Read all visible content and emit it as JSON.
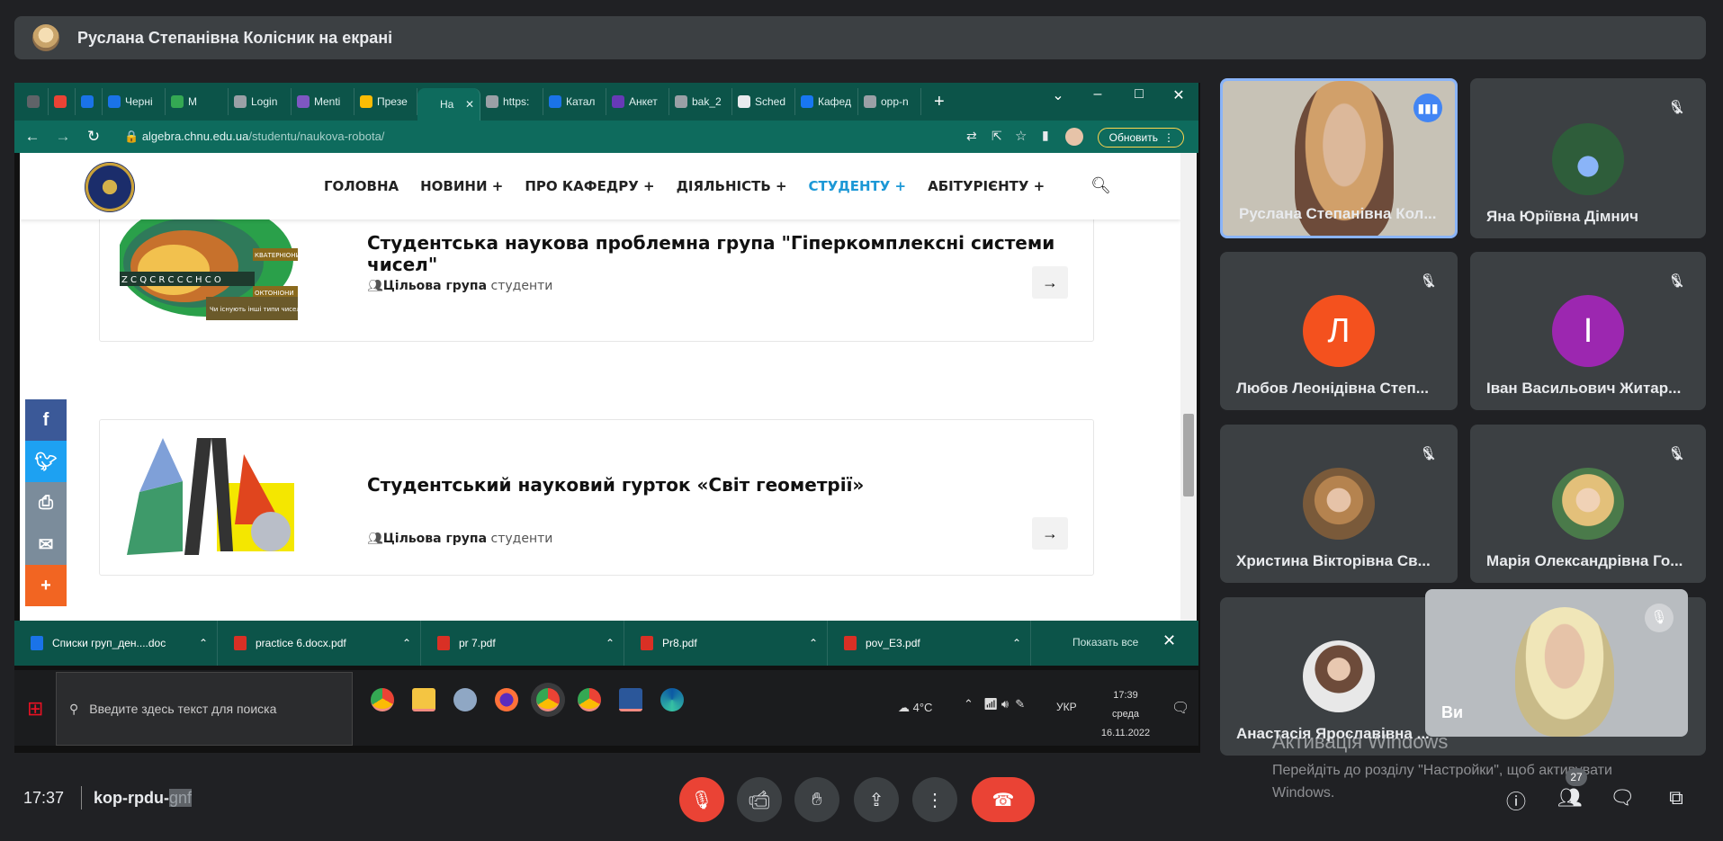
{
  "presenter_banner": "Руслана Степанівна Колісник на екрані",
  "browser": {
    "tabs": [
      {
        "label": "",
        "color": "#5f6368"
      },
      {
        "label": "",
        "color": "#ea4335"
      },
      {
        "label": "",
        "color": "#1a73e8"
      },
      {
        "label": "Черні",
        "color": "#1a73e8"
      },
      {
        "label": "M",
        "color": "#34a853"
      },
      {
        "label": "Login",
        "color": "#9aa0a6"
      },
      {
        "label": "Menti",
        "color": "#7e57c2"
      },
      {
        "label": "Презе",
        "color": "#fbbc04"
      },
      {
        "label": "На",
        "color": "#0e6b5d"
      },
      {
        "label": "https:",
        "color": "#9aa0a6"
      },
      {
        "label": "Катал",
        "color": "#1a73e8"
      },
      {
        "label": "Анкет",
        "color": "#673ab7"
      },
      {
        "label": "bak_2",
        "color": "#9aa0a6"
      },
      {
        "label": "Sched",
        "color": "#e8eaed"
      },
      {
        "label": "Кафед",
        "color": "#1877f2"
      },
      {
        "label": "opp-n",
        "color": "#9aa0a6"
      }
    ],
    "url_domain": "algebra.chnu.edu.ua",
    "url_path": "/studentu/naukova-robota/",
    "update_label": "Обновить"
  },
  "site": {
    "menu": [
      "ГОЛОВНА",
      "НОВИНИ +",
      "ПРО КАФЕДРУ +",
      "ДІЯЛЬНІСТЬ +",
      "СТУДЕНТУ +",
      "АБІТУРІЄНТУ +"
    ],
    "active_menu_index": 4,
    "cards": [
      {
        "title": "Студентська наукова проблемна група \"Гіперкомплексні системи чисел\"",
        "meta_label": "Цільова група",
        "meta_value": "студенти",
        "image_text": [
          "КВАТЕРНІОНИ",
          "ОКТОНІОНИ",
          "Чи існують інші типи чисел?",
          "Z C Q C R C C C H C O"
        ]
      },
      {
        "title": "Студентський науковий гурток «Світ геометрії»",
        "meta_label": "Цільова група",
        "meta_value": "студенти"
      }
    ]
  },
  "downloads": [
    {
      "name": "Списки груп_ден....doc",
      "type": "doc"
    },
    {
      "name": "practice 6.docx.pdf",
      "type": "pdf"
    },
    {
      "name": "pr 7.pdf",
      "type": "pdf"
    },
    {
      "name": "Pr8.pdf",
      "type": "pdf"
    },
    {
      "name": "pov_E3.pdf",
      "type": "pdf"
    }
  ],
  "downloads_show_all": "Показать все",
  "taskbar": {
    "search_placeholder": "Введите здесь текст для поиска",
    "weather": "4°C",
    "lang": "УКР",
    "time": "17:39",
    "day": "среда",
    "date": "16.11.2022"
  },
  "participants": [
    {
      "name": "Руслана Степанівна Кол...",
      "speaking": true
    },
    {
      "name": "Яна Юріївна Дімнич",
      "muted": true
    },
    {
      "name": "Любов Леонідівна Степ...",
      "letter": "Л",
      "color": "#f4511e",
      "muted": true
    },
    {
      "name": "Іван Васильович Житар...",
      "letter": "І",
      "color": "#9c27b0",
      "muted": true
    },
    {
      "name": "Христина Вікторівна Св...",
      "muted": true
    },
    {
      "name": "Марія Олександрівна Го...",
      "muted": true
    },
    {
      "name": "Анастасія Ярославівна ...",
      "muted": true
    }
  ],
  "self_label": "Ви",
  "activation": {
    "title": "Активація Windows",
    "line1": "Перейдіть до розділу \"Настройки\", щоб активувати",
    "line2": "Windows."
  },
  "meet": {
    "time": "17:37",
    "code_visible": "kop-rpdu-",
    "code_highlight": "gnf",
    "participant_count": "27"
  }
}
